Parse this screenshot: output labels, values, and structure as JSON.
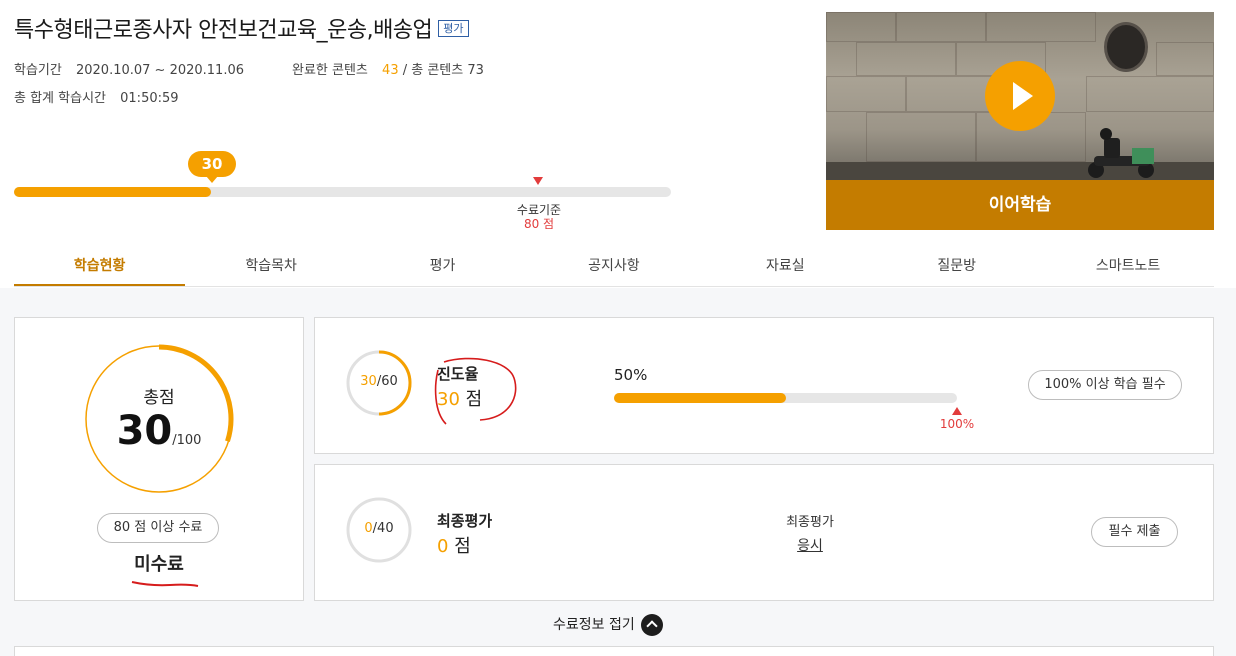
{
  "header": {
    "title": "특수형태근로종사자 안전보건교육_운송,배송업",
    "badge": "평가",
    "period_label": "학습기간",
    "period_value": "2020.10.07 ~ 2020.11.06",
    "completed_label": "완료한 콘텐츠",
    "completed_value": "43",
    "total_label": "/ 총 콘텐츠 73",
    "time_label": "총 합계 학습시간",
    "time_value": "01:50:59"
  },
  "progress": {
    "current": "30",
    "current_fraction": 0.3,
    "threshold_label": "수료기준",
    "threshold_value": "80 점",
    "threshold_fraction": 0.8
  },
  "video": {
    "continue_label": "이어학습",
    "play_icon": "play-icon"
  },
  "tabs": [
    {
      "label": "학습현황",
      "active": true
    },
    {
      "label": "학습목차"
    },
    {
      "label": "평가"
    },
    {
      "label": "공지사항"
    },
    {
      "label": "자료실"
    },
    {
      "label": "질문방"
    },
    {
      "label": "스마트노트"
    }
  ],
  "summary": {
    "total_label": "총점",
    "score": "30",
    "max": "/100",
    "score_fraction": 0.3,
    "requirement": "80 점 이상 수료",
    "status": "미수료"
  },
  "progress_row": {
    "circle_value": "30",
    "circle_max": "/60",
    "circle_fraction": 0.5,
    "title": "진도율",
    "score": "30",
    "unit": "점",
    "percent_text": "50%",
    "percent_fraction": 0.5,
    "target": "100%",
    "requirement": "100% 이상 학습 필수"
  },
  "final_row": {
    "circle_value": "0",
    "circle_max": "/40",
    "circle_fraction": 0,
    "title": "최종평가",
    "score": "0",
    "unit": "점",
    "center_label": "최종평가",
    "center_link": "응시",
    "requirement": "필수 제출"
  },
  "fold": {
    "label": "수료정보 접기",
    "icon": "chevron-up-icon"
  },
  "colors": {
    "accent": "#f5a000",
    "dark_accent": "#c47c00",
    "alert": "#e23c3c",
    "annotation": "#d61c1c"
  }
}
